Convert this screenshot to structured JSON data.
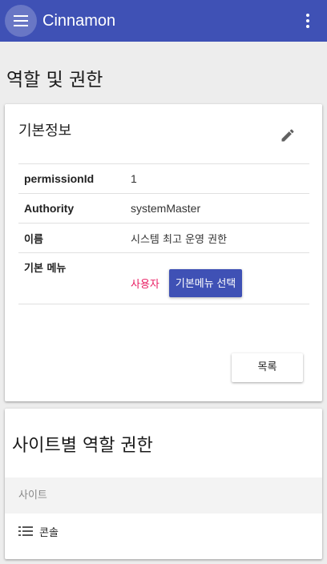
{
  "appbar": {
    "title": "Cinnamon",
    "accent_color": "#3f51b5",
    "menu_icon": "menu-icon",
    "more_icon": "more-vert-icon"
  },
  "page": {
    "title": "역할 및 권한"
  },
  "basic_info": {
    "title": "기본정보",
    "edit_icon": "edit-icon",
    "rows": [
      {
        "key": "permissionId",
        "value": "1"
      },
      {
        "key": "Authority",
        "value": "systemMaster"
      },
      {
        "key": "이름",
        "value": "시스템 최고 운영 권한"
      }
    ],
    "default_menu": {
      "key": "기본 메뉴",
      "value": "사용자",
      "select_label": "기본메뉴 선택"
    },
    "list_button": "목록"
  },
  "site_roles": {
    "title": "사이트별 역할 권한",
    "column_header": "사이트",
    "items": [
      {
        "icon": "list-icon",
        "label": "콘솔"
      }
    ]
  }
}
